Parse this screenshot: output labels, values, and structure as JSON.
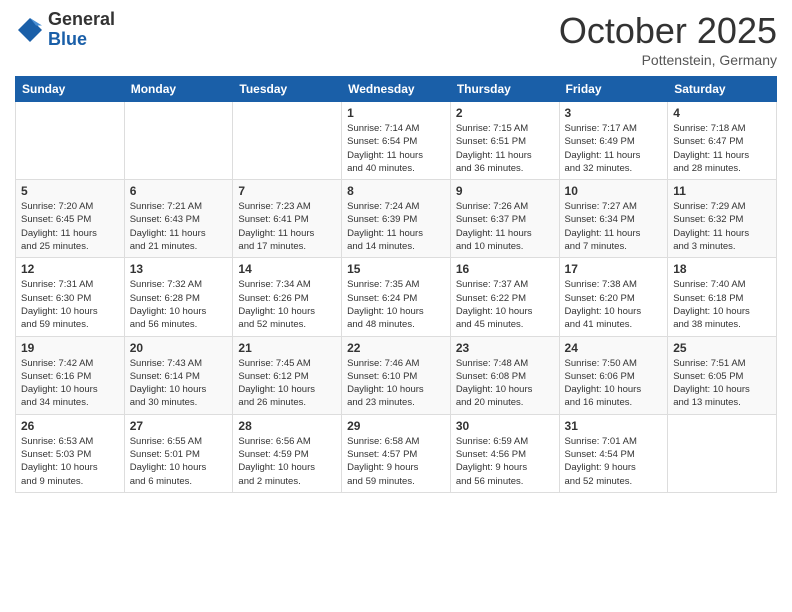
{
  "logo": {
    "general": "General",
    "blue": "Blue"
  },
  "header": {
    "month": "October 2025",
    "location": "Pottenstein, Germany"
  },
  "weekdays": [
    "Sunday",
    "Monday",
    "Tuesday",
    "Wednesday",
    "Thursday",
    "Friday",
    "Saturday"
  ],
  "weeks": [
    [
      {
        "day": "",
        "info": ""
      },
      {
        "day": "",
        "info": ""
      },
      {
        "day": "",
        "info": ""
      },
      {
        "day": "1",
        "info": "Sunrise: 7:14 AM\nSunset: 6:54 PM\nDaylight: 11 hours\nand 40 minutes."
      },
      {
        "day": "2",
        "info": "Sunrise: 7:15 AM\nSunset: 6:51 PM\nDaylight: 11 hours\nand 36 minutes."
      },
      {
        "day": "3",
        "info": "Sunrise: 7:17 AM\nSunset: 6:49 PM\nDaylight: 11 hours\nand 32 minutes."
      },
      {
        "day": "4",
        "info": "Sunrise: 7:18 AM\nSunset: 6:47 PM\nDaylight: 11 hours\nand 28 minutes."
      }
    ],
    [
      {
        "day": "5",
        "info": "Sunrise: 7:20 AM\nSunset: 6:45 PM\nDaylight: 11 hours\nand 25 minutes."
      },
      {
        "day": "6",
        "info": "Sunrise: 7:21 AM\nSunset: 6:43 PM\nDaylight: 11 hours\nand 21 minutes."
      },
      {
        "day": "7",
        "info": "Sunrise: 7:23 AM\nSunset: 6:41 PM\nDaylight: 11 hours\nand 17 minutes."
      },
      {
        "day": "8",
        "info": "Sunrise: 7:24 AM\nSunset: 6:39 PM\nDaylight: 11 hours\nand 14 minutes."
      },
      {
        "day": "9",
        "info": "Sunrise: 7:26 AM\nSunset: 6:37 PM\nDaylight: 11 hours\nand 10 minutes."
      },
      {
        "day": "10",
        "info": "Sunrise: 7:27 AM\nSunset: 6:34 PM\nDaylight: 11 hours\nand 7 minutes."
      },
      {
        "day": "11",
        "info": "Sunrise: 7:29 AM\nSunset: 6:32 PM\nDaylight: 11 hours\nand 3 minutes."
      }
    ],
    [
      {
        "day": "12",
        "info": "Sunrise: 7:31 AM\nSunset: 6:30 PM\nDaylight: 10 hours\nand 59 minutes."
      },
      {
        "day": "13",
        "info": "Sunrise: 7:32 AM\nSunset: 6:28 PM\nDaylight: 10 hours\nand 56 minutes."
      },
      {
        "day": "14",
        "info": "Sunrise: 7:34 AM\nSunset: 6:26 PM\nDaylight: 10 hours\nand 52 minutes."
      },
      {
        "day": "15",
        "info": "Sunrise: 7:35 AM\nSunset: 6:24 PM\nDaylight: 10 hours\nand 48 minutes."
      },
      {
        "day": "16",
        "info": "Sunrise: 7:37 AM\nSunset: 6:22 PM\nDaylight: 10 hours\nand 45 minutes."
      },
      {
        "day": "17",
        "info": "Sunrise: 7:38 AM\nSunset: 6:20 PM\nDaylight: 10 hours\nand 41 minutes."
      },
      {
        "day": "18",
        "info": "Sunrise: 7:40 AM\nSunset: 6:18 PM\nDaylight: 10 hours\nand 38 minutes."
      }
    ],
    [
      {
        "day": "19",
        "info": "Sunrise: 7:42 AM\nSunset: 6:16 PM\nDaylight: 10 hours\nand 34 minutes."
      },
      {
        "day": "20",
        "info": "Sunrise: 7:43 AM\nSunset: 6:14 PM\nDaylight: 10 hours\nand 30 minutes."
      },
      {
        "day": "21",
        "info": "Sunrise: 7:45 AM\nSunset: 6:12 PM\nDaylight: 10 hours\nand 26 minutes."
      },
      {
        "day": "22",
        "info": "Sunrise: 7:46 AM\nSunset: 6:10 PM\nDaylight: 10 hours\nand 23 minutes."
      },
      {
        "day": "23",
        "info": "Sunrise: 7:48 AM\nSunset: 6:08 PM\nDaylight: 10 hours\nand 20 minutes."
      },
      {
        "day": "24",
        "info": "Sunrise: 7:50 AM\nSunset: 6:06 PM\nDaylight: 10 hours\nand 16 minutes."
      },
      {
        "day": "25",
        "info": "Sunrise: 7:51 AM\nSunset: 6:05 PM\nDaylight: 10 hours\nand 13 minutes."
      }
    ],
    [
      {
        "day": "26",
        "info": "Sunrise: 6:53 AM\nSunset: 5:03 PM\nDaylight: 10 hours\nand 9 minutes."
      },
      {
        "day": "27",
        "info": "Sunrise: 6:55 AM\nSunset: 5:01 PM\nDaylight: 10 hours\nand 6 minutes."
      },
      {
        "day": "28",
        "info": "Sunrise: 6:56 AM\nSunset: 4:59 PM\nDaylight: 10 hours\nand 2 minutes."
      },
      {
        "day": "29",
        "info": "Sunrise: 6:58 AM\nSunset: 4:57 PM\nDaylight: 9 hours\nand 59 minutes."
      },
      {
        "day": "30",
        "info": "Sunrise: 6:59 AM\nSunset: 4:56 PM\nDaylight: 9 hours\nand 56 minutes."
      },
      {
        "day": "31",
        "info": "Sunrise: 7:01 AM\nSunset: 4:54 PM\nDaylight: 9 hours\nand 52 minutes."
      },
      {
        "day": "",
        "info": ""
      }
    ]
  ]
}
